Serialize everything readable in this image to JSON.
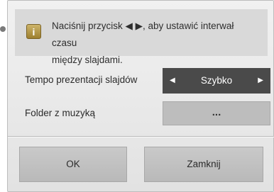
{
  "info": {
    "icon": "info-icon",
    "icon_glyph": "i",
    "message_line1": "Naciśnij przycisk ◀ ▶, aby ustawić interwał czasu",
    "message_line2": "między slajdami."
  },
  "settings": {
    "speed": {
      "label": "Tempo prezentacji slajdów",
      "value": "Szybko",
      "left_arrow": "◀",
      "right_arrow": "▶"
    },
    "music_folder": {
      "label": "Folder z muzyką",
      "button_label": "..."
    }
  },
  "buttons": {
    "ok_label": "OK",
    "close_label": "Zamknij"
  },
  "colors": {
    "spinner_bg": "#4a4a4a",
    "info_icon": "#b89a45",
    "dialog_bg": "#e8e8e8"
  }
}
